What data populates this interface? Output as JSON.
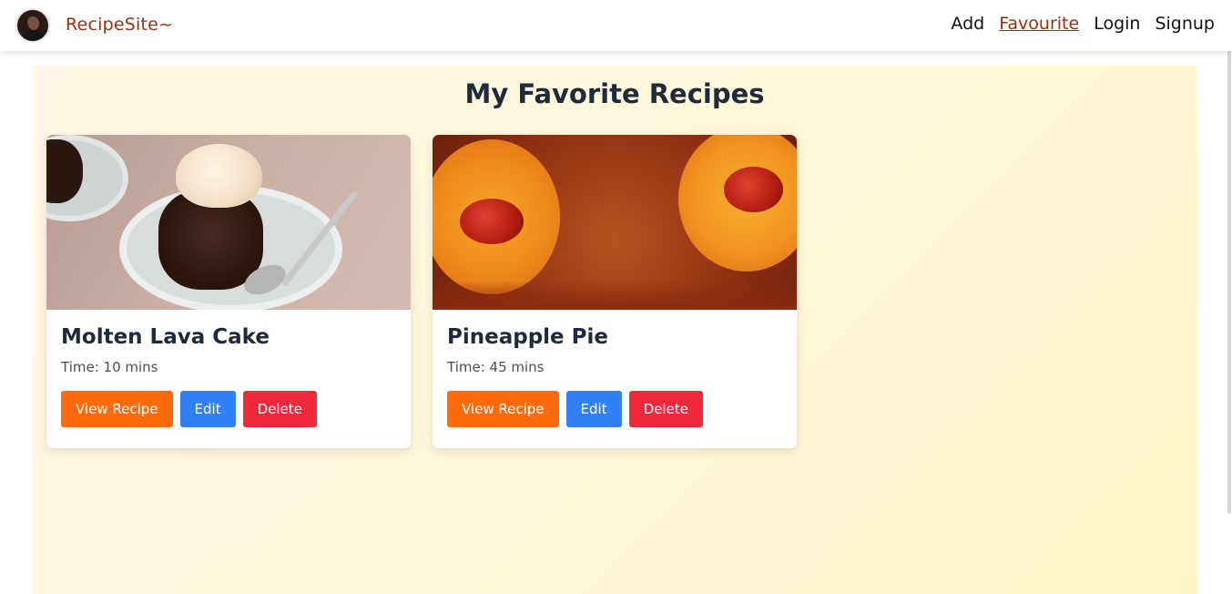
{
  "navbar": {
    "brand": "RecipeSite~",
    "links": [
      {
        "label": "Add",
        "active": false
      },
      {
        "label": "Favourite",
        "active": true
      },
      {
        "label": "Login",
        "active": false
      },
      {
        "label": "Signup",
        "active": false
      }
    ]
  },
  "main": {
    "title": "My Favorite Recipes",
    "cards": [
      {
        "title": "Molten Lava Cake",
        "time": "Time: 10 mins",
        "image_icon": "molten-lava-cake-photo",
        "view_label": "View Recipe",
        "edit_label": "Edit",
        "delete_label": "Delete"
      },
      {
        "title": "Pineapple Pie",
        "time": "Time: 45 mins",
        "image_icon": "pineapple-pie-photo",
        "view_label": "View Recipe",
        "edit_label": "Edit",
        "delete_label": "Delete"
      }
    ]
  },
  "colors": {
    "brand": "#9a2e0e",
    "view_button": "#ff6a0a",
    "edit_button": "#2f80f5",
    "delete_button": "#f0283c",
    "title_text": "#1f2a3a"
  }
}
